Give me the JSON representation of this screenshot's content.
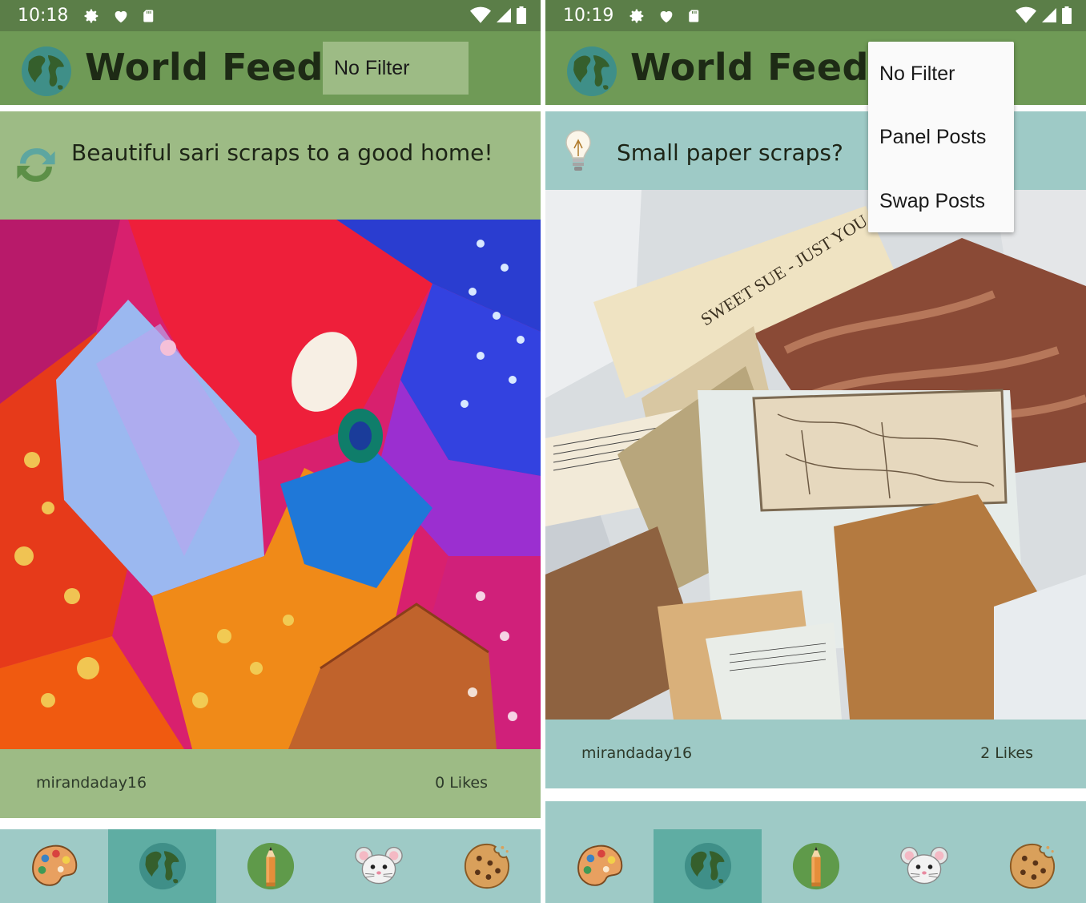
{
  "left": {
    "status": {
      "time": "10:18"
    },
    "app_title": "World Feed",
    "filter_value": "No Filter",
    "post": {
      "title": "Beautiful sari scraps to a good home!",
      "username": "mirandaday16",
      "likes": "0 Likes",
      "type_icon": "swap-icon"
    },
    "nav": [
      "palette-icon",
      "globe-icon",
      "pencil-icon",
      "mouse-icon",
      "cookie-icon"
    ],
    "nav_active_index": 1
  },
  "right": {
    "status": {
      "time": "10:19"
    },
    "app_title": "World Feed",
    "post": {
      "title": "Small paper scraps?",
      "username": "mirandaday16",
      "likes": "2 Likes",
      "type_icon": "lightbulb-icon"
    },
    "filter_menu": [
      "No Filter",
      "Panel Posts",
      "Swap Posts"
    ],
    "nav": [
      "palette-icon",
      "globe-icon",
      "pencil-icon",
      "mouse-icon",
      "cookie-icon"
    ],
    "nav_active_index": 1
  },
  "colors": {
    "status_bar": "#5b7e48",
    "app_bar": "#6f9a56",
    "swap_card": "#9dbb85",
    "panel_card": "#9ecac6",
    "nav_bar": "#9ecac6",
    "nav_active": "#5fada3"
  }
}
